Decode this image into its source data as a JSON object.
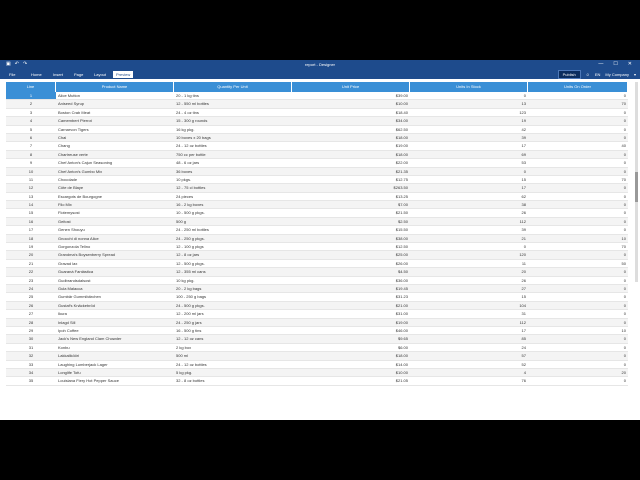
{
  "window": {
    "title": "report - Designer",
    "minimize": "—",
    "maximize": "☐",
    "close": "✕"
  },
  "menu": {
    "items": [
      "File",
      "Home",
      "Insert",
      "Page",
      "Layout",
      "Preview"
    ],
    "active": 5,
    "publish": "Publish",
    "lang": "EN",
    "company": "My Company"
  },
  "table": {
    "headers": [
      "Line",
      "Product Name",
      "Quantity Per Unit",
      "Unit Price",
      "Units In Stock",
      "Units On Order"
    ],
    "rows": [
      [
        "1",
        "Alice Mutton",
        "20 - 1 kg tins",
        "$39.00",
        "0",
        "0"
      ],
      [
        "2",
        "Aniseed Syrup",
        "12 - 550 ml bottles",
        "$10.00",
        "13",
        "70"
      ],
      [
        "3",
        "Boston Crab Meat",
        "24 - 4 oz tins",
        "$18.40",
        "123",
        "0"
      ],
      [
        "4",
        "Camembert Pierrot",
        "15 - 300 g rounds",
        "$34.00",
        "19",
        "0"
      ],
      [
        "5",
        "Carnarvon Tigers",
        "16 kg pkg.",
        "$62.50",
        "42",
        "0"
      ],
      [
        "6",
        "Chai",
        "10 boxes x 20 bags",
        "$18.00",
        "39",
        "0"
      ],
      [
        "7",
        "Chang",
        "24 - 12 oz bottles",
        "$19.00",
        "17",
        "40"
      ],
      [
        "8",
        "Chartreuse verte",
        "750 cc per bottle",
        "$18.00",
        "69",
        "0"
      ],
      [
        "9",
        "Chef Anton's Cajun Seasoning",
        "48 - 6 oz jars",
        "$22.00",
        "53",
        "0"
      ],
      [
        "10",
        "Chef Anton's Gumbo Mix",
        "36 boxes",
        "$21.35",
        "0",
        "0"
      ],
      [
        "11",
        "Chocolade",
        "10 pkgs.",
        "$12.75",
        "15",
        "70"
      ],
      [
        "12",
        "Côte de Blaye",
        "12 - 75 cl bottles",
        "$263.50",
        "17",
        "0"
      ],
      [
        "13",
        "Escargots de Bourgogne",
        "24 pieces",
        "$13.25",
        "62",
        "0"
      ],
      [
        "14",
        "Filo Mix",
        "16 - 2 kg boxes",
        "$7.00",
        "38",
        "0"
      ],
      [
        "15",
        "Flotemysost",
        "10 - 500 g pkgs.",
        "$21.50",
        "26",
        "0"
      ],
      [
        "16",
        "Geitost",
        "500 g",
        "$2.50",
        "112",
        "0"
      ],
      [
        "17",
        "Genen Shouyu",
        "24 - 250 ml bottles",
        "$15.50",
        "39",
        "0"
      ],
      [
        "18",
        "Gnocchi di nonna Alice",
        "24 - 250 g pkgs.",
        "$38.00",
        "21",
        "10"
      ],
      [
        "19",
        "Gorgonzola Telino",
        "12 - 100 g pkgs",
        "$12.50",
        "0",
        "70"
      ],
      [
        "20",
        "Grandma's Boysenberry Spread",
        "12 - 8 oz jars",
        "$25.00",
        "120",
        "0"
      ],
      [
        "21",
        "Gravad lax",
        "12 - 500 g pkgs.",
        "$26.00",
        "11",
        "50"
      ],
      [
        "22",
        "Guaraná Fantástica",
        "12 - 355 ml cans",
        "$4.50",
        "20",
        "0"
      ],
      [
        "23",
        "Gudbrandsdalsost",
        "10 kg pkg.",
        "$36.00",
        "26",
        "0"
      ],
      [
        "24",
        "Gula Malacca",
        "20 - 2 kg bags",
        "$19.45",
        "27",
        "0"
      ],
      [
        "25",
        "Gumbär Gummibärchen",
        "100 - 250 g bags",
        "$31.23",
        "15",
        "0"
      ],
      [
        "26",
        "Gustaf's Knäckebröd",
        "24 - 500 g pkgs.",
        "$21.00",
        "104",
        "0"
      ],
      [
        "27",
        "Ikura",
        "12 - 200 ml jars",
        "$31.00",
        "31",
        "0"
      ],
      [
        "28",
        "Inlagd Sill",
        "24 - 250 g  jars",
        "$19.00",
        "112",
        "0"
      ],
      [
        "29",
        "Ipoh Coffee",
        "16 - 500 g tins",
        "$46.00",
        "17",
        "10"
      ],
      [
        "30",
        "Jack's New England Clam Chowder",
        "12 - 12 oz cans",
        "$9.65",
        "85",
        "0"
      ],
      [
        "31",
        "Konbu",
        "2 kg box",
        "$6.00",
        "24",
        "0"
      ],
      [
        "32",
        "Lakkalikööri",
        "500 ml",
        "$18.00",
        "57",
        "0"
      ],
      [
        "33",
        "Laughing Lumberjack Lager",
        "24 - 12 oz bottles",
        "$14.00",
        "52",
        "0"
      ],
      [
        "34",
        "Longlife Tofu",
        "5 kg pkg.",
        "$10.00",
        "4",
        "20"
      ],
      [
        "35",
        "Louisiana Fiery Hot Pepper Sauce",
        "32 - 8 oz bottles",
        "$21.05",
        "76",
        "0"
      ]
    ]
  }
}
